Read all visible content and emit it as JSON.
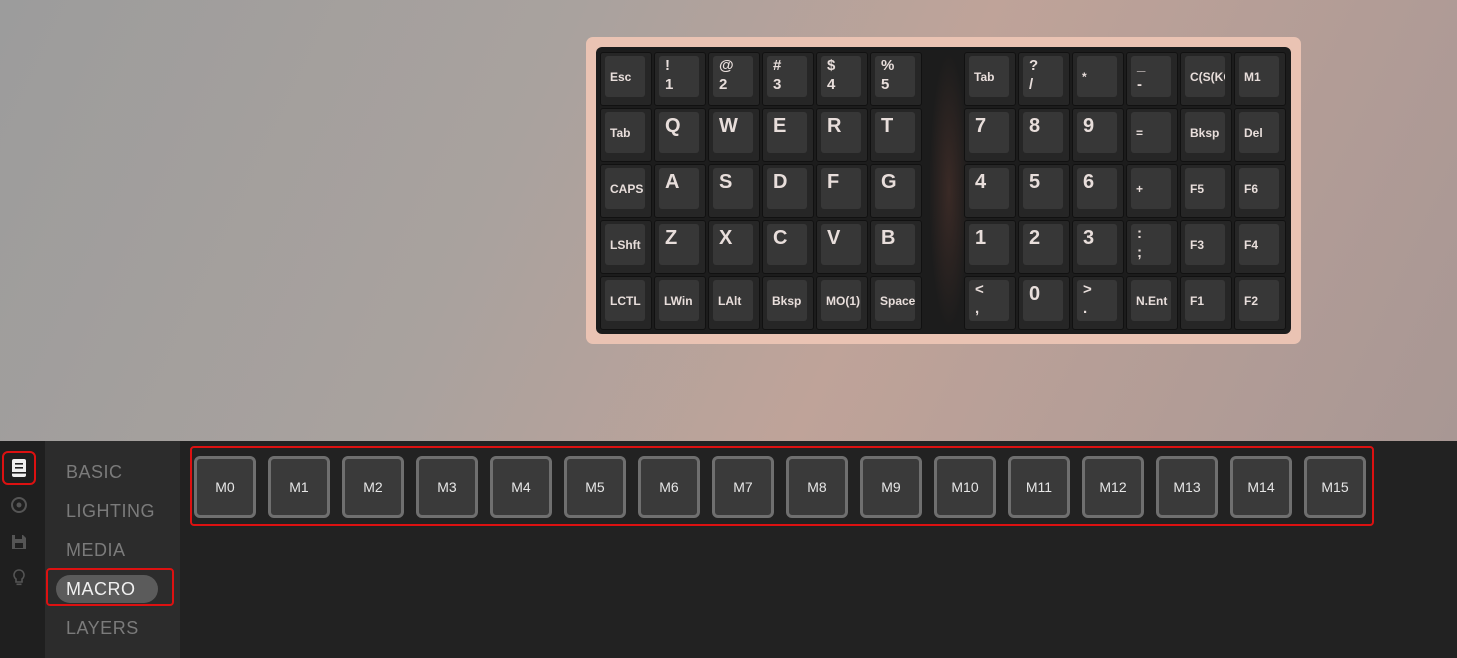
{
  "keyboard": {
    "left": [
      [
        {
          "t": "Esc",
          "s": "small"
        },
        {
          "t": "!",
          "b": "1"
        },
        {
          "t": "@",
          "b": "2"
        },
        {
          "t": "#",
          "b": "3"
        },
        {
          "t": "$",
          "b": "4"
        },
        {
          "t": "%",
          "b": "5"
        }
      ],
      [
        {
          "t": "Tab",
          "s": "small"
        },
        {
          "t": "Q",
          "s": "big"
        },
        {
          "t": "W",
          "s": "big"
        },
        {
          "t": "E",
          "s": "big"
        },
        {
          "t": "R",
          "s": "big"
        },
        {
          "t": "T",
          "s": "big"
        }
      ],
      [
        {
          "t": "CAPS",
          "s": "small"
        },
        {
          "t": "A",
          "s": "big"
        },
        {
          "t": "S",
          "s": "big"
        },
        {
          "t": "D",
          "s": "big"
        },
        {
          "t": "F",
          "s": "big"
        },
        {
          "t": "G",
          "s": "big"
        }
      ],
      [
        {
          "t": "LShft",
          "s": "small"
        },
        {
          "t": "Z",
          "s": "big"
        },
        {
          "t": "X",
          "s": "big"
        },
        {
          "t": "C",
          "s": "big"
        },
        {
          "t": "V",
          "s": "big"
        },
        {
          "t": "B",
          "s": "big"
        }
      ],
      [
        {
          "t": "LCTL",
          "s": "small"
        },
        {
          "t": "LWin",
          "s": "small"
        },
        {
          "t": "LAlt",
          "s": "small"
        },
        {
          "t": "Bksp",
          "s": "small"
        },
        {
          "t": "MO(1)",
          "s": "small"
        },
        {
          "t": "Space",
          "s": "small"
        }
      ]
    ],
    "right": [
      [
        {
          "t": "Tab",
          "s": "small"
        },
        {
          "t": "?",
          "b": "/"
        },
        {
          "t": "*",
          "s": "small"
        },
        {
          "t": "_",
          "b": "-"
        },
        {
          "t": "C(S(KC",
          "s": "small"
        },
        {
          "t": "M1",
          "s": "small"
        }
      ],
      [
        {
          "t": "7",
          "s": "big"
        },
        {
          "t": "8",
          "s": "big"
        },
        {
          "t": "9",
          "s": "big"
        },
        {
          "t": "=",
          "s": "small"
        },
        {
          "t": "Bksp",
          "s": "small"
        },
        {
          "t": "Del",
          "s": "small"
        }
      ],
      [
        {
          "t": "4",
          "s": "big"
        },
        {
          "t": "5",
          "s": "big"
        },
        {
          "t": "6",
          "s": "big"
        },
        {
          "t": "+",
          "s": "small"
        },
        {
          "t": "F5",
          "s": "small"
        },
        {
          "t": "F6",
          "s": "small"
        }
      ],
      [
        {
          "t": "1",
          "s": "big"
        },
        {
          "t": "2",
          "s": "big"
        },
        {
          "t": "3",
          "s": "big"
        },
        {
          "t": ":",
          "b": ";"
        },
        {
          "t": "F3",
          "s": "small"
        },
        {
          "t": "F4",
          "s": "small"
        }
      ],
      [
        {
          "t": "<",
          "b": ","
        },
        {
          "t": "0",
          "s": "big"
        },
        {
          "t": ">",
          "b": "."
        },
        {
          "t": "N.Ent",
          "s": "small"
        },
        {
          "t": "F1",
          "s": "small"
        },
        {
          "t": "F2",
          "s": "small"
        }
      ]
    ]
  },
  "iconbar": [
    "configure-icon",
    "gear-icon",
    "save-icon",
    "lightbulb-icon"
  ],
  "menu": {
    "items": [
      "BASIC",
      "LIGHTING",
      "MEDIA",
      "MACRO",
      "LAYERS"
    ],
    "active": "MACRO"
  },
  "macros": [
    "M0",
    "M1",
    "M2",
    "M3",
    "M4",
    "M5",
    "M6",
    "M7",
    "M8",
    "M9",
    "M10",
    "M11",
    "M12",
    "M13",
    "M14",
    "M15"
  ],
  "colors": {
    "highlight": "#dd1111",
    "accent": "#eac3b3"
  }
}
